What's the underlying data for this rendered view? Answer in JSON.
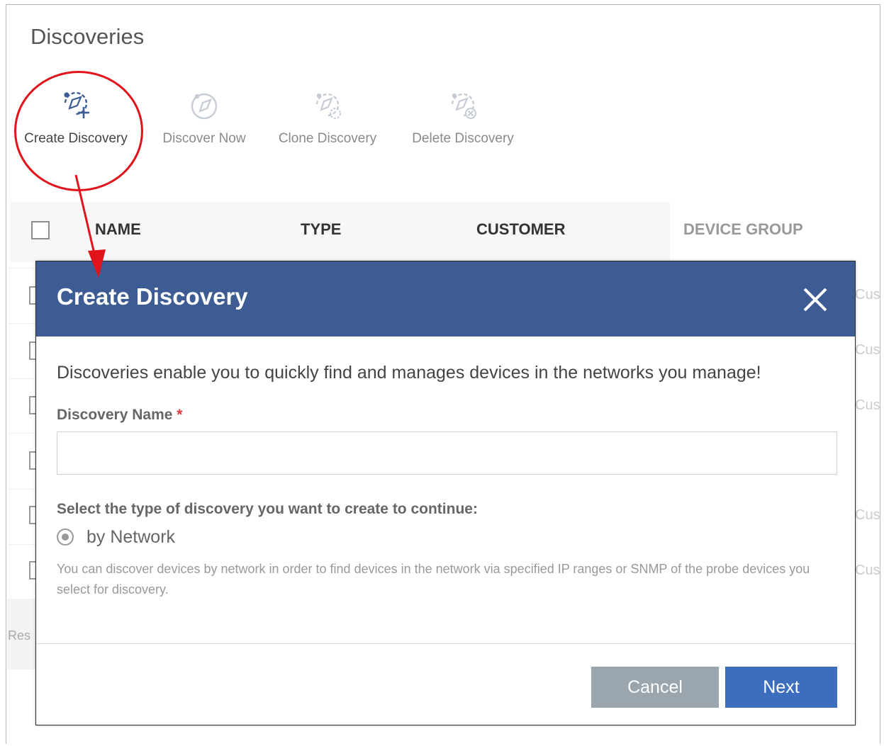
{
  "page": {
    "title": "Discoveries"
  },
  "toolbar": {
    "create": "Create Discovery",
    "discover_now": "Discover Now",
    "clone": "Clone Discovery",
    "delete": "Delete Discovery"
  },
  "table": {
    "columns": [
      "NAME",
      "TYPE",
      "CUSTOMER",
      "DEVICE GROUP"
    ],
    "row_customer_fragment": "Cus",
    "footer_fragment": "Res"
  },
  "modal": {
    "title": "Create Discovery",
    "intro": "Discoveries enable you to quickly find and manages devices in the networks you manage!",
    "name_label": "Discovery Name",
    "required_mark": "*",
    "name_value": "",
    "type_prompt": "Select the type of discovery you want to create to continue:",
    "type_option": "by Network",
    "type_description": "You can discover devices by network in order to find devices in the network via specified IP ranges or SNMP of the probe devices you select for discovery.",
    "cancel_label": "Cancel",
    "next_label": "Next"
  },
  "colors": {
    "header_blue": "#3d5c93",
    "next_button": "#3d6dbd",
    "cancel_button": "#9aa5ad",
    "annotation_red": "#e1141c"
  }
}
